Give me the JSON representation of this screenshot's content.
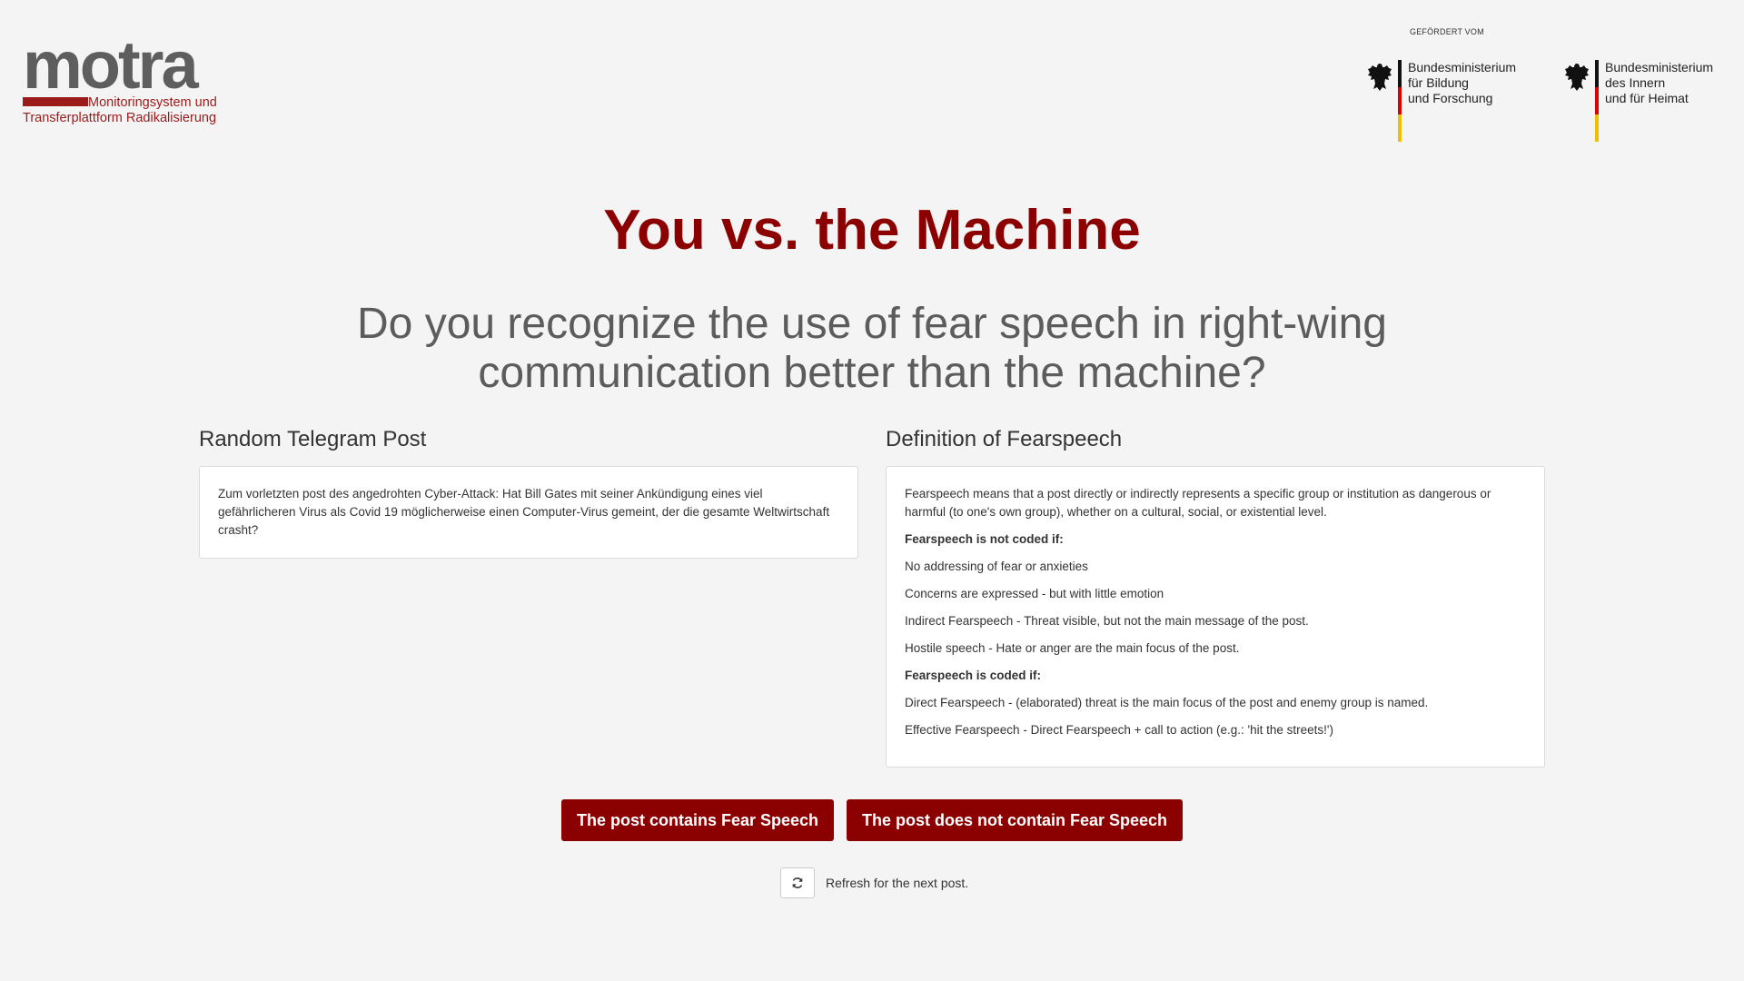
{
  "header": {
    "logo_word": "motra",
    "logo_sub1": "Monitoringsystem und",
    "logo_sub2": "Transferplattform Radikalisierung",
    "funding_label": "GEFÖRDERT VOM",
    "ministries": [
      {
        "lines": [
          "Bundesministerium",
          "für Bildung",
          "und Forschung"
        ]
      },
      {
        "lines": [
          "Bundesministerium",
          "des Innern",
          "und für Heimat"
        ]
      }
    ]
  },
  "title": "You vs. the Machine",
  "subtitle": "Do you recognize the use of fear speech in right-wing communication better than the machine?",
  "post": {
    "heading": "Random Telegram Post",
    "text": "Zum vorletzten post des angedrohten Cyber-Attack: Hat Bill Gates mit seiner Ankündigung eines viel gefährlicheren Virus als Covid 19 möglicherweise einen Computer-Virus gemeint, der die gesamte Weltwirtschaft crasht?"
  },
  "definition": {
    "heading": "Definition of Fearspeech",
    "intro": "Fearspeech means that a post directly or indirectly represents a specific group or institution as dangerous or harmful (to one's own group), whether on a cultural, social, or existential level.",
    "not_coded_heading": "Fearspeech is not coded if:",
    "not_coded": [
      "No addressing of fear or anxieties",
      "Concerns are expressed - but with little emotion",
      "Indirect Fearspeech - Threat visible, but not the main message of the post.",
      "Hostile speech - Hate or anger are the main focus of the post."
    ],
    "coded_heading": "Fearspeech is coded if:",
    "coded": [
      "Direct Fearspeech - (elaborated) threat is the main focus of the post and enemy group is named.",
      "Effective Fearspeech - Direct Fearspeech + call to action (e.g.: 'hit the streets!')"
    ]
  },
  "buttons": {
    "contains": "The post contains Fear Speech",
    "not_contains": "The post does not contain Fear Speech"
  },
  "refresh": {
    "label": "Refresh for the next post.",
    "icon": "refresh-icon"
  },
  "colors": {
    "accent": "#8b0000",
    "background": "#f4f4f4",
    "logo_red": "#9b1b1b"
  }
}
